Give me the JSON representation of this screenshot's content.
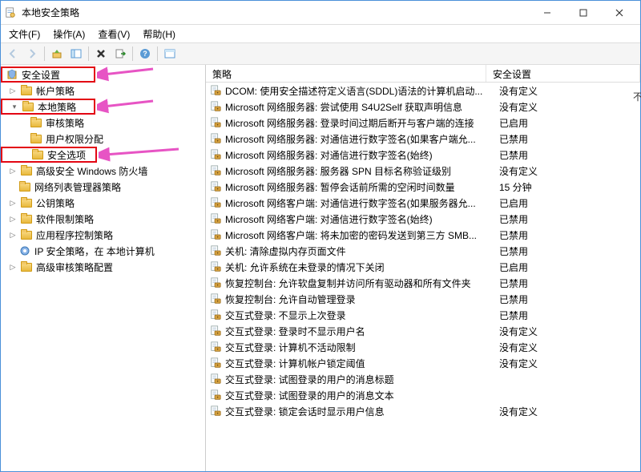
{
  "window": {
    "title": "本地安全策略"
  },
  "menubar": {
    "file": "文件(F)",
    "action": "操作(A)",
    "view": "查看(V)",
    "help": "帮助(H)"
  },
  "tree": {
    "root": "安全设置",
    "account": "帐户策略",
    "local": "本地策略",
    "audit": "审核策略",
    "rights": "用户权限分配",
    "options": "安全选项",
    "firewall": "高级安全 Windows 防火墙",
    "netlist": "网络列表管理器策略",
    "pubkey": "公钥策略",
    "software": "软件限制策略",
    "appctrl": "应用程序控制策略",
    "ipsec": "IP 安全策略，在 本地计算机",
    "advaudit": "高级审核策略配置"
  },
  "columns": {
    "policy": "策略",
    "setting": "安全设置"
  },
  "rows": [
    {
      "p": "DCOM: 使用安全描述符定义语言(SDDL)语法的计算机启动...",
      "s": "没有定义"
    },
    {
      "p": "Microsoft 网络服务器: 尝试使用 S4U2Self 获取声明信息",
      "s": "没有定义"
    },
    {
      "p": "Microsoft 网络服务器: 登录时间过期后断开与客户端的连接",
      "s": "已启用"
    },
    {
      "p": "Microsoft 网络服务器: 对通信进行数字签名(如果客户端允...",
      "s": "已禁用"
    },
    {
      "p": "Microsoft 网络服务器: 对通信进行数字签名(始终)",
      "s": "已禁用"
    },
    {
      "p": "Microsoft 网络服务器: 服务器 SPN 目标名称验证级别",
      "s": "没有定义"
    },
    {
      "p": "Microsoft 网络服务器: 暂停会话前所需的空闲时间数量",
      "s": "15 分钟"
    },
    {
      "p": "Microsoft 网络客户端: 对通信进行数字签名(如果服务器允...",
      "s": "已启用"
    },
    {
      "p": "Microsoft 网络客户端: 对通信进行数字签名(始终)",
      "s": "已禁用"
    },
    {
      "p": "Microsoft 网络客户端: 将未加密的密码发送到第三方 SMB...",
      "s": "已禁用"
    },
    {
      "p": "关机: 清除虚拟内存页面文件",
      "s": "已禁用"
    },
    {
      "p": "关机: 允许系统在未登录的情况下关闭",
      "s": "已启用"
    },
    {
      "p": "恢复控制台: 允许软盘复制并访问所有驱动器和所有文件夹",
      "s": "已禁用"
    },
    {
      "p": "恢复控制台: 允许自动管理登录",
      "s": "已禁用"
    },
    {
      "p": "交互式登录: 不显示上次登录",
      "s": "已禁用"
    },
    {
      "p": "交互式登录: 登录时不显示用户名",
      "s": "没有定义"
    },
    {
      "p": "交互式登录: 计算机不活动限制",
      "s": "没有定义"
    },
    {
      "p": "交互式登录: 计算机帐户锁定阈值",
      "s": "没有定义"
    },
    {
      "p": "交互式登录: 试图登录的用户的消息标题",
      "s": ""
    },
    {
      "p": "交互式登录: 试图登录的用户的消息文本",
      "s": ""
    },
    {
      "p": "交互式登录: 锁定会话时显示用户信息",
      "s": "没有定义"
    }
  ],
  "outside_text": "不"
}
